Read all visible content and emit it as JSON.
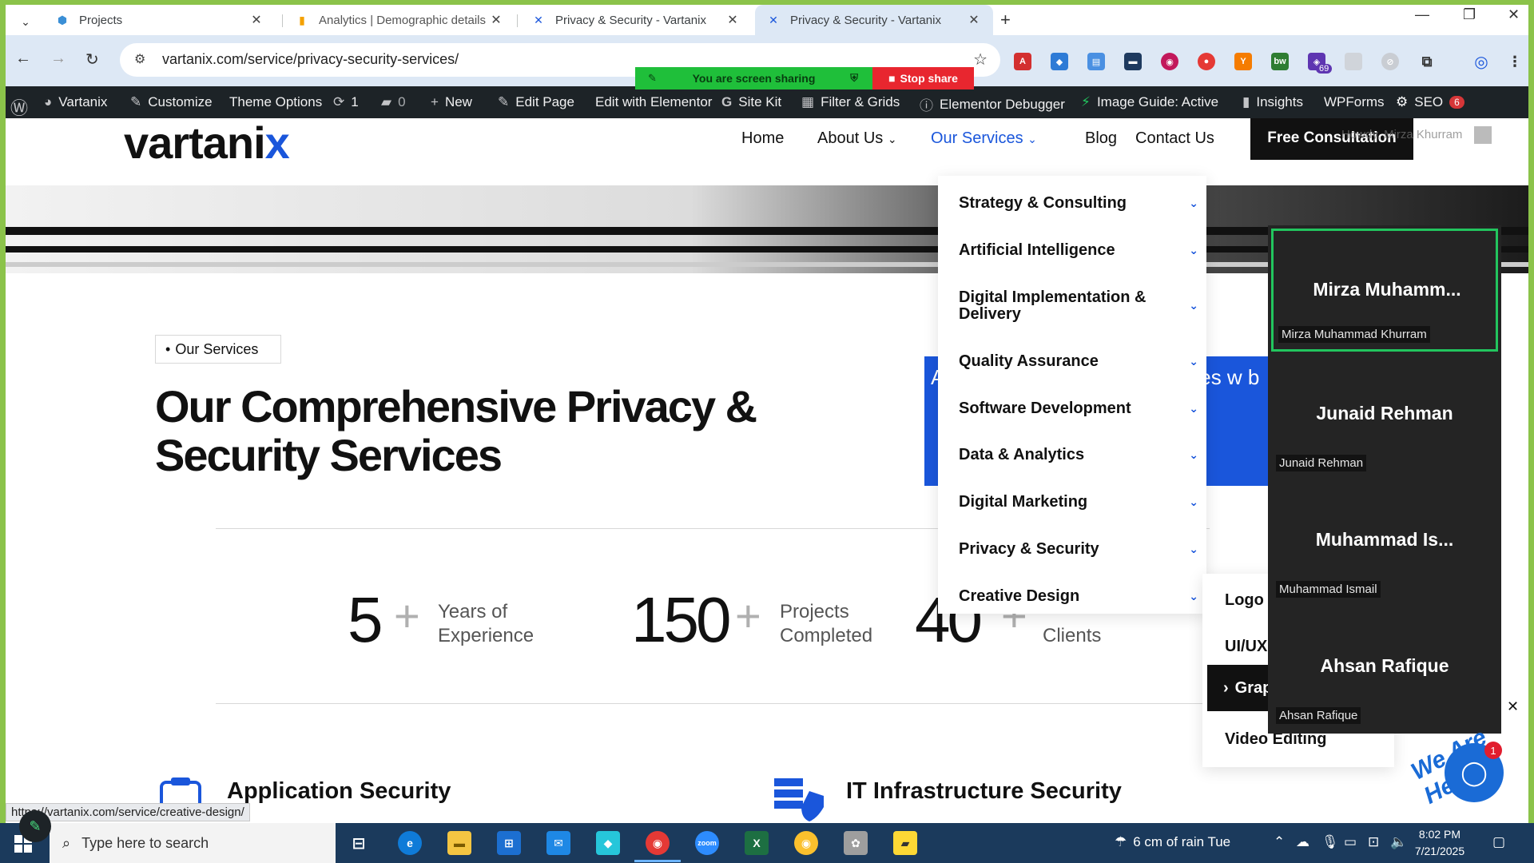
{
  "browser": {
    "tabs": [
      {
        "title": "Projects",
        "active": false
      },
      {
        "title": "Analytics | Demographic details",
        "active": false
      },
      {
        "title": "Privacy & Security - Vartanix",
        "active": false
      },
      {
        "title": "Privacy & Security - Vartanix",
        "active": true
      }
    ],
    "url": "vartanix.com/service/privacy-security-services/",
    "extension_badge": "69",
    "status_url": "https://vartanix.com/service/creative-design/"
  },
  "screen_share": {
    "message": "You are screen sharing",
    "stop_label": "Stop share"
  },
  "admin_bar": {
    "site": "Vartanix",
    "customize": "Customize",
    "theme_options": "Theme Options",
    "updates": "1",
    "comments": "0",
    "new": "New",
    "edit_page": "Edit Page",
    "edit_elementor": "Edit with Elementor",
    "site_kit": "Site Kit",
    "filter_grids": "Filter & Grids",
    "debugger": "Elementor Debugger",
    "image_guide": "Image Guide: Active",
    "insights": "Insights",
    "wpforms": "WPForms",
    "seo": "SEO",
    "seo_count": "6",
    "howdy": "Howdy, Mirza Khurram"
  },
  "site": {
    "logo": "vartani",
    "logo_x": "x",
    "nav": [
      "Home",
      "About Us",
      "Our Services",
      "Blog",
      "Contact Us"
    ],
    "cta": "Free Consultation",
    "kicker": "Our Services",
    "heading": "Our Comprehensive Privacy & Security Services",
    "stats": [
      {
        "value": "5",
        "label": "Years of Experience"
      },
      {
        "value": "150",
        "label": "Projects Completed"
      },
      {
        "value": "40",
        "label": "Clients"
      }
    ],
    "blue_text": "A offer sec s en your c r ategies w b",
    "services": [
      "Application Security",
      "IT Infrastructure Security"
    ]
  },
  "services_menu": [
    "Strategy & Consulting",
    "Artificial Intelligence",
    "Digital Implementation & Delivery",
    "Quality Assurance",
    "Software Development",
    "Data & Analytics",
    "Digital Marketing",
    "Privacy & Security",
    "Creative Design"
  ],
  "creative_submenu": [
    "Logo D",
    "UI/UX D",
    "Grap",
    "Video Editing"
  ],
  "zoom": [
    {
      "tile": "Mirza  Muhamm...",
      "name": "Mirza Muhammad Khurram",
      "speaking": true
    },
    {
      "tile": "Junaid Rehman",
      "name": "Junaid Rehman",
      "speaking": false
    },
    {
      "tile": "Muhammad  Is...",
      "name": "Muhammad Ismail",
      "speaking": false
    },
    {
      "tile": "Ahsan Rafique",
      "name": "Ahsan Rafique",
      "speaking": false
    }
  ],
  "chat": {
    "badge": "1",
    "teaser": "We Are Here"
  },
  "taskbar": {
    "search_placeholder": "Type here to search",
    "weather": "6 cm of rain Tue",
    "time": "8:02 PM",
    "date": "7/21/2025"
  }
}
